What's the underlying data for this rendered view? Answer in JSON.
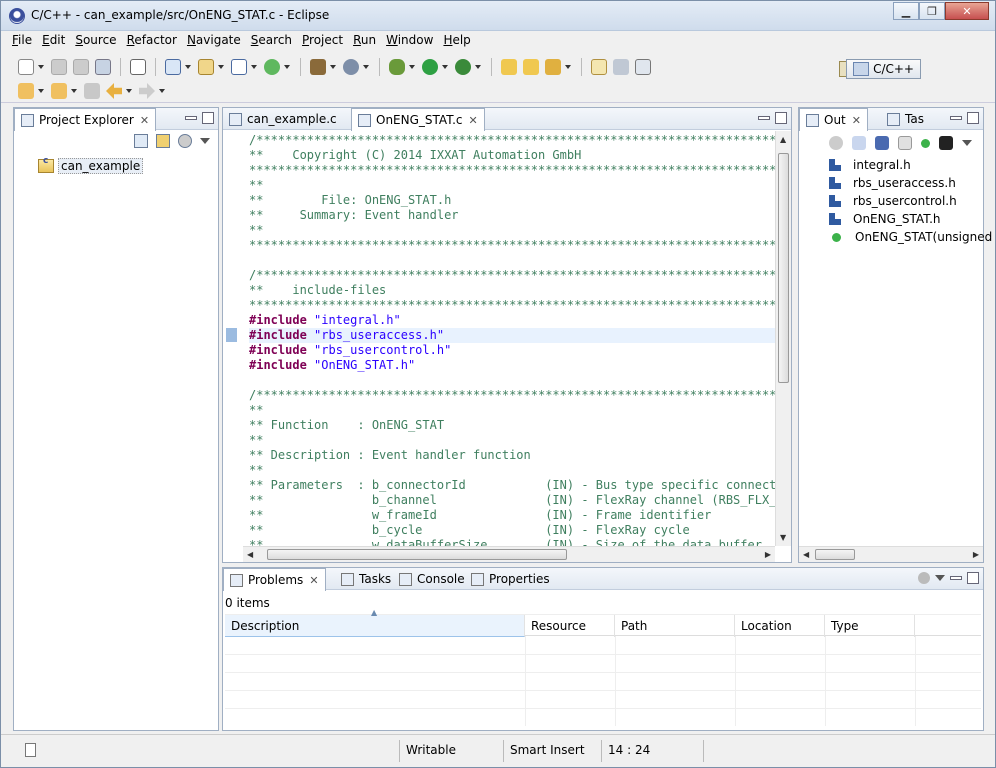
{
  "window": {
    "title": "C/C++ - can_example/src/OnENG_STAT.c - Eclipse"
  },
  "menu": [
    "File",
    "Edit",
    "Source",
    "Refactor",
    "Navigate",
    "Search",
    "Project",
    "Run",
    "Window",
    "Help"
  ],
  "perspective": {
    "label": "C/C++"
  },
  "explorer": {
    "tab": "Project Explorer",
    "project": "can_example"
  },
  "editor": {
    "tabs": [
      "can_example.c",
      "OnENG_STAT.c"
    ],
    "lines": [
      {
        "t": "/*****************************************************************************",
        "k": "cmt"
      },
      {
        "t": "**    Copyright (C) 2014 IXXAT Automation GmbH",
        "k": "cmt"
      },
      {
        "t": "*****************************************************************************",
        "k": "cmt"
      },
      {
        "t": "**",
        "k": "cmt"
      },
      {
        "t": "**        File: OnENG_STAT.h",
        "k": "cmt"
      },
      {
        "t": "**     Summary: Event handler",
        "k": "cmt"
      },
      {
        "t": "**",
        "k": "cmt"
      },
      {
        "t": "*****************************************************************************",
        "k": "cmt"
      },
      {
        "t": "",
        "k": "cmt"
      },
      {
        "t": "/*****************************************************************************",
        "k": "cmt"
      },
      {
        "t": "**    include-files",
        "k": "cmt"
      },
      {
        "t": "*****************************************************************************",
        "k": "cmt"
      },
      {
        "t": "#include",
        "s": " \"integral.h\"",
        "k": "inc"
      },
      {
        "t": "#include",
        "s": " \"rbs_useraccess.h\"",
        "k": "inc",
        "cur": true
      },
      {
        "t": "#include",
        "s": " \"rbs_usercontrol.h\"",
        "k": "inc"
      },
      {
        "t": "#include",
        "s": " \"OnENG_STAT.h\"",
        "k": "inc"
      },
      {
        "t": "",
        "k": "cmt"
      },
      {
        "t": "/*****************************************************************************",
        "k": "cmt"
      },
      {
        "t": "**",
        "k": "cmt"
      },
      {
        "t": "** Function    : OnENG_STAT",
        "k": "cmt"
      },
      {
        "t": "**",
        "k": "cmt"
      },
      {
        "t": "** Description : Event handler function",
        "k": "cmt"
      },
      {
        "t": "**",
        "k": "cmt"
      },
      {
        "t": "** Parameters  : b_connectorId           (IN) - Bus type specific connector",
        "k": "cmt"
      },
      {
        "t": "**               b_channel               (IN) - FlexRay channel (RBS_FLX_CH",
        "k": "cmt"
      },
      {
        "t": "**               w_frameId               (IN) - Frame identifier",
        "k": "cmt"
      },
      {
        "t": "**               b_cycle                 (IN) - FlexRay cycle",
        "k": "cmt"
      },
      {
        "t": "**               w_dataBufferSize        (IN) - Size of the data buffer",
        "k": "cmt"
      }
    ]
  },
  "outline": {
    "tabs": [
      "Out",
      "Tas"
    ],
    "items": [
      {
        "label": "integral.h",
        "icon": "include"
      },
      {
        "label": "rbs_useraccess.h",
        "icon": "include"
      },
      {
        "label": "rbs_usercontrol.h",
        "icon": "include"
      },
      {
        "label": "OnENG_STAT.h",
        "icon": "include"
      },
      {
        "label": "OnENG_STAT(unsigned",
        "icon": "function"
      }
    ]
  },
  "problems": {
    "tabs": [
      "Problems",
      "Tasks",
      "Console",
      "Properties"
    ],
    "count": "0 items",
    "columns": [
      "Description",
      "Resource",
      "Path",
      "Location",
      "Type"
    ]
  },
  "status": {
    "writable": "Writable",
    "insert_mode": "Smart Insert",
    "position": "14 : 24"
  }
}
